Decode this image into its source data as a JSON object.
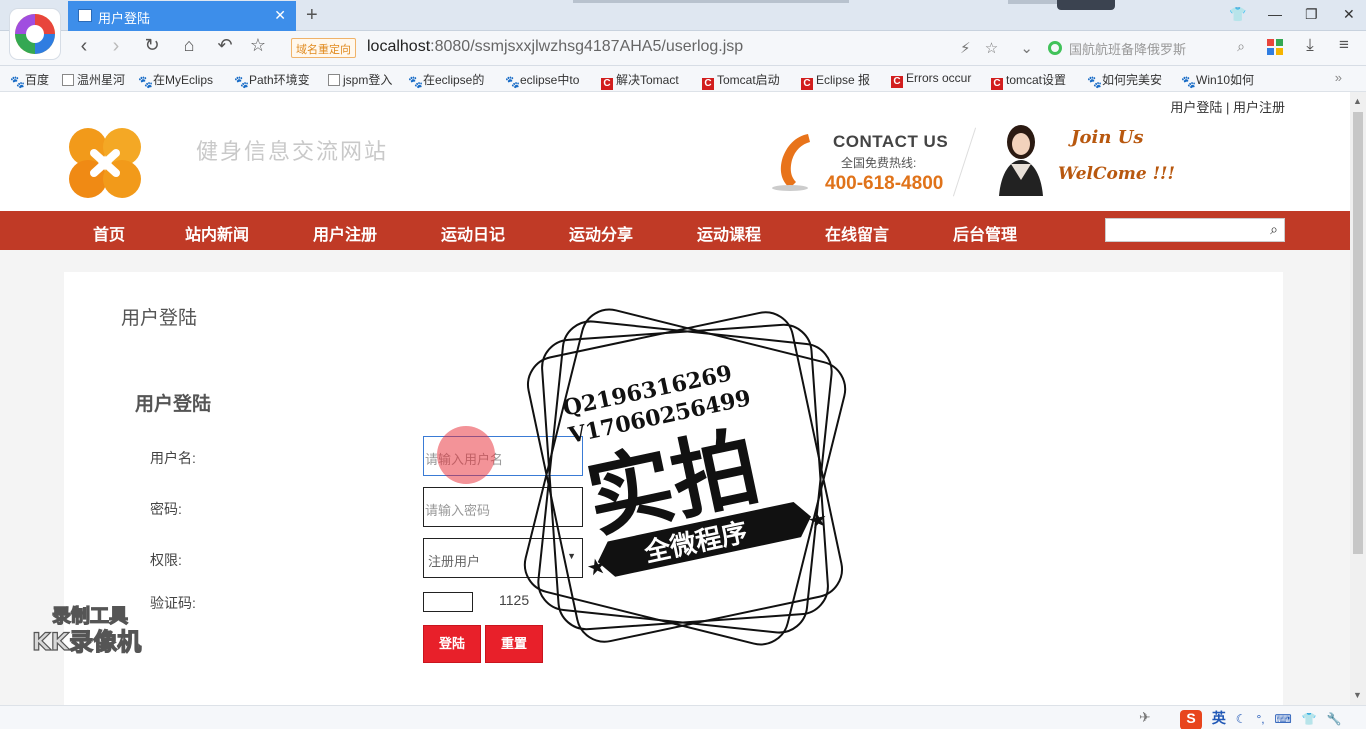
{
  "browser": {
    "tab_title": "用户登陆",
    "address_tag": "域名重定向",
    "address_host": "localhost",
    "address_rest": ":8080/ssmjsxxjlwzhsg4187AHA5/userlog.jsp",
    "search_text": "国航航班备降俄罗斯",
    "bookmarks": [
      "百度",
      "温州星河",
      "在MyEclips",
      "Path环境变",
      "jspm登入",
      "在eclipse的",
      "eclipse中to",
      "解决Tomact",
      "Tomcat启动",
      "Eclipse 报",
      "Errors occur",
      "tomcat设置",
      "如何完美安",
      "Win10如何"
    ]
  },
  "site": {
    "top_links": "用户登陆 | 用户注册",
    "title": "健身信息交流网站",
    "contact_title": "CONTACT US",
    "contact_sub": "全国免费热线:",
    "contact_phone": "400-618-4800",
    "join_line1": "Join Us",
    "join_line2": "WelCome !!!",
    "menu": [
      "首页",
      "站内新闻",
      "用户注册",
      "运动日记",
      "运动分享",
      "运动课程",
      "在线留言",
      "后台管理"
    ]
  },
  "login": {
    "crumb_title": "用户登陆",
    "form_title": "用户登陆",
    "username_label": "用户名:",
    "username_placeholder": "请输入用户名",
    "password_label": "密码:",
    "password_placeholder": "请输入密码",
    "role_label": "权限:",
    "role_value": "注册用户",
    "captcha_label": "验证码:",
    "captcha_code": "1125",
    "login_button": "登陆",
    "reset_button": "重置"
  },
  "overlay": {
    "stamp_line1": "Q2196316269",
    "stamp_line2": "V17060256499",
    "stamp_big": "实拍",
    "stamp_banner": "全微程序",
    "watermark_line1": "录制工具",
    "watermark_line2": "KK录像机"
  },
  "status": {
    "ime_lang": "英"
  },
  "colors": {
    "menu_red": "#c03a26",
    "button_red": "#e8202a",
    "tab_blue": "#3d8eea",
    "phone_orange": "#e0731a"
  }
}
